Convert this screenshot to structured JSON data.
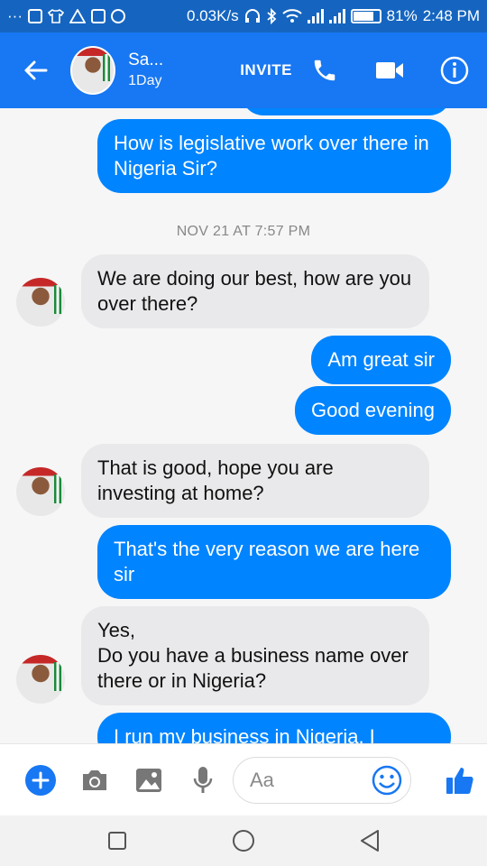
{
  "status_bar": {
    "overflow": "···",
    "network_speed": "0.03K/s",
    "battery": "81%",
    "battery_level": 0.81,
    "time": "2:48 PM",
    "icons": [
      "mail-icon",
      "shirt-icon",
      "warning-icon",
      "cast-icon",
      "whatsapp-icon",
      "headphones-icon",
      "bluetooth-icon",
      "wifi-icon",
      "signal-icon",
      "battery-icon"
    ]
  },
  "header": {
    "contact_name": "Sa...",
    "contact_status": "1Day",
    "invite_label": "INVITE",
    "icons": [
      "back-arrow-icon",
      "phone-icon",
      "video-camera-icon",
      "info-icon"
    ],
    "color": "#1877f2"
  },
  "messages": [
    {
      "side": "out",
      "text": "How is legislative work over there in Nigeria Sir?"
    },
    {
      "type": "timestamp",
      "text": "NOV 21 AT 7:57 PM"
    },
    {
      "side": "in",
      "text": "We are doing our best, how are you over there?"
    },
    {
      "side": "out",
      "text": "Am great sir"
    },
    {
      "side": "out",
      "text": "Good evening"
    },
    {
      "side": "in",
      "text": "That is good, hope you are investing at home?"
    },
    {
      "side": "out",
      "text": "That's the very reason we are here sir"
    },
    {
      "side": "in",
      "text": "Yes,\nDo you have a business name over there or in Nigeria?"
    },
    {
      "side": "out",
      "text": "I run my business in Nigeria, I"
    }
  ],
  "colors": {
    "outgoing_bubble": "#0084ff",
    "incoming_bubble": "#e9e9eb",
    "accent": "#1877f2"
  },
  "composer": {
    "placeholder": "Aa",
    "icons": [
      "plus-icon",
      "camera-icon",
      "image-icon",
      "microphone-icon",
      "emoji-icon",
      "thumbs-up-icon"
    ]
  },
  "nav": {
    "icons": [
      "recent-apps-icon",
      "home-icon",
      "back-icon"
    ]
  }
}
